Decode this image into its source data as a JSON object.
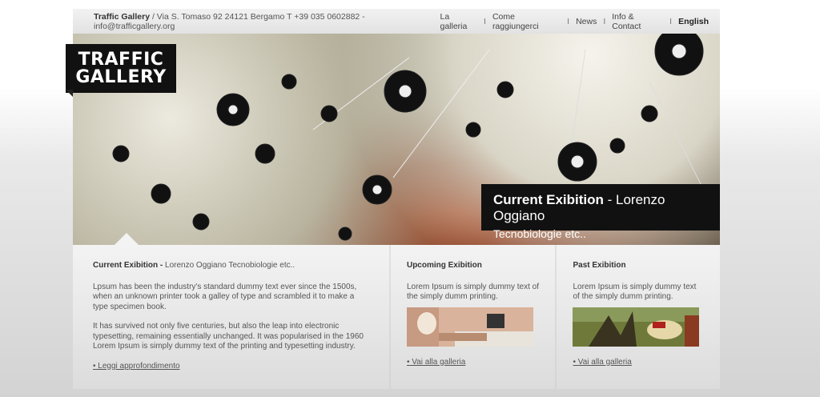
{
  "topbar": {
    "brand": "Traffic Gallery",
    "address": " / Via S. Tomaso 92  24121 Bergamo T +39 035 0602882 - info@trafficgallery.org"
  },
  "nav": [
    {
      "label": "La galleria"
    },
    {
      "label": "Come raggiungerci"
    },
    {
      "label": "News"
    },
    {
      "label": "Info & Contact"
    },
    {
      "label": "English"
    }
  ],
  "logo": {
    "line1": "TRAFFIC",
    "line2": "GALLERY"
  },
  "hero_caption": {
    "title_bold": "Current Exibition",
    "title_rest": " - Lorenzo Oggiano",
    "subtitle": "Tecnobiologie etc.."
  },
  "current": {
    "heading_bold": "Current Exibition -",
    "heading_rest": " Lorenzo Oggiano Tecnobiologie etc..",
    "para1": "Lpsum has been the industry's standard dummy text ever since the 1500s, when an unknown printer took a galley of type and scrambled it to make a type specimen book.",
    "para2": "It has survived not only five centuries, but also the leap into electronic typesetting, remaining essentially unchanged. It was popularised in the 1960 Lorem Ipsum is simply dummy text of the printing and typesetting industry.",
    "link": "• Leggi approfondimento"
  },
  "upcoming": {
    "heading": "Upcoming Exibition",
    "text": "Lorem Ipsum is simply dummy text of the simply dumm printing.",
    "link": "• Vai alla galleria"
  },
  "past": {
    "heading": "Past Exibition",
    "text": "Lorem Ipsum is simply dummy text of the simply dumm printing.",
    "link": "• Vai alla galleria"
  }
}
